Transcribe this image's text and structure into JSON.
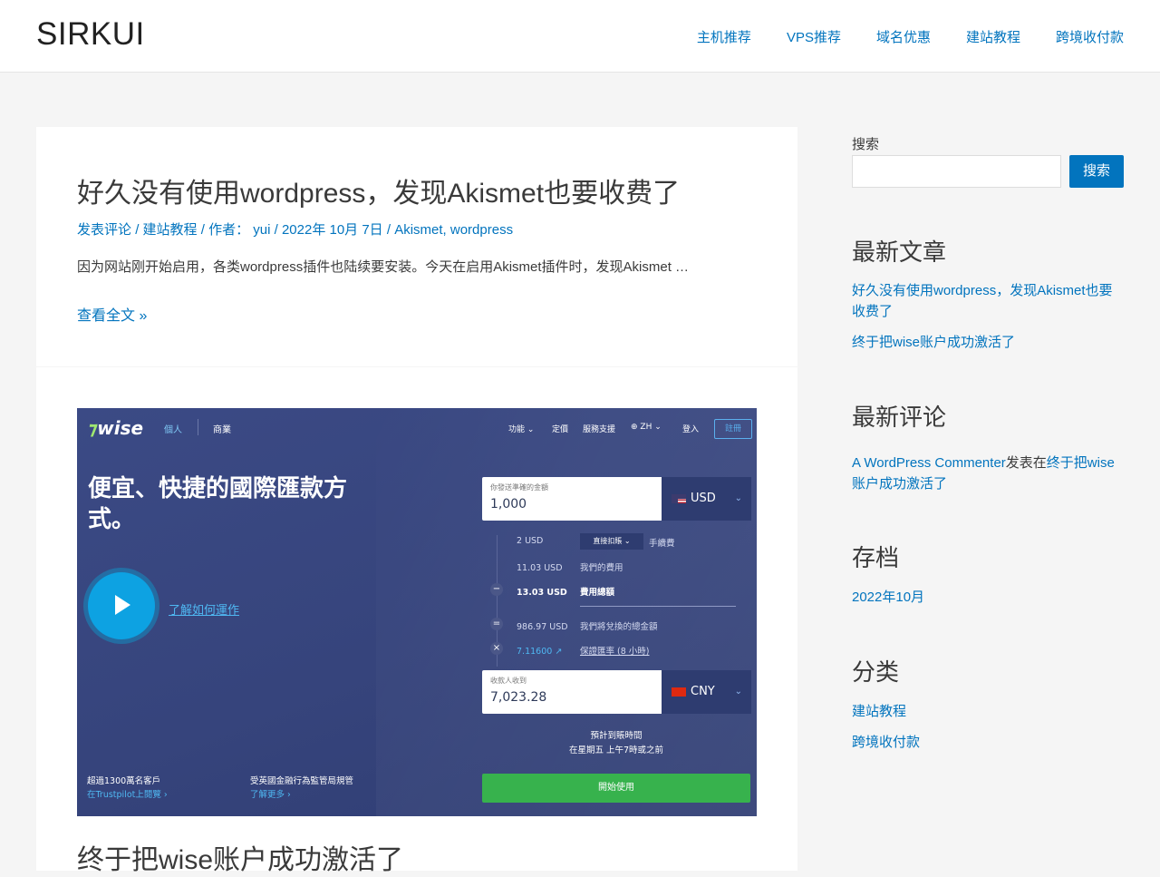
{
  "header": {
    "site_title": "SIRKUI",
    "nav": [
      "主机推荐",
      "VPS推荐",
      "域名优惠",
      "建站教程",
      "跨境收付款"
    ]
  },
  "posts": [
    {
      "title": "好久没有使用wordpress，发现Akismet也要收费了",
      "meta": {
        "comments": "发表评论",
        "category": "建站教程",
        "author_label": "作者：",
        "author": "yui",
        "date": "2022年 10月 7日",
        "tags": "Akismet, wordpress"
      },
      "excerpt": "因为网站刚开始启用，各类wordpress插件也陆续要安装。今天在启用Akismet插件时，发现Akismet …",
      "read_more": "查看全文 »"
    },
    {
      "title": "终于把wise账户成功激活了",
      "image": {
        "logo": "wise",
        "tab_personal": "個人",
        "tab_business": "商業",
        "nav": [
          "功能",
          "定價",
          "服務支援",
          "ZH",
          "登入"
        ],
        "register": "註冊",
        "headline": "便宜、快捷的國際匯款方式。",
        "how_it_works": "了解如何運作",
        "send_label": "你發送準確的金額",
        "send_value": "1,000",
        "send_currency": "USD",
        "rows": [
          {
            "amount": "2 USD",
            "text": "直接扣賬",
            "suffix": "手續費"
          },
          {
            "amount": "11.03 USD",
            "text": "我們的費用"
          },
          {
            "amount": "13.03 USD",
            "text": "費用總額"
          },
          {
            "amount": "986.97 USD",
            "text": "我們將兌換的總金額"
          },
          {
            "amount": "7.11600",
            "text": "保證匯率 (8 小時)"
          }
        ],
        "receive_label": "收款人收到",
        "receive_value": "7,023.28",
        "receive_currency": "CNY",
        "eta_title": "預計到賬時間",
        "eta_text": "在星期五 上午7時或之前",
        "customers_title": "超過1300萬名客戶",
        "customers_link": "在Trustpilot上閱覽",
        "regulated_title": "受英國金融行為監管局規管",
        "regulated_link": "了解更多",
        "start_button": "開始使用"
      }
    }
  ],
  "sidebar": {
    "search_label": "搜索",
    "search_button": "搜索",
    "recent_posts_title": "最新文章",
    "recent_posts": [
      "好久没有使用wordpress，发现Akismet也要收费了",
      "终于把wise账户成功激活了"
    ],
    "recent_comments_title": "最新评论",
    "comment_author": "A WordPress Commenter",
    "comment_on": "发表在",
    "comment_post": "终于把wise账户成功激活了",
    "archives_title": "存档",
    "archives": [
      "2022年10月"
    ],
    "categories_title": "分类",
    "categories": [
      "建站教程",
      "跨境收付款"
    ]
  }
}
